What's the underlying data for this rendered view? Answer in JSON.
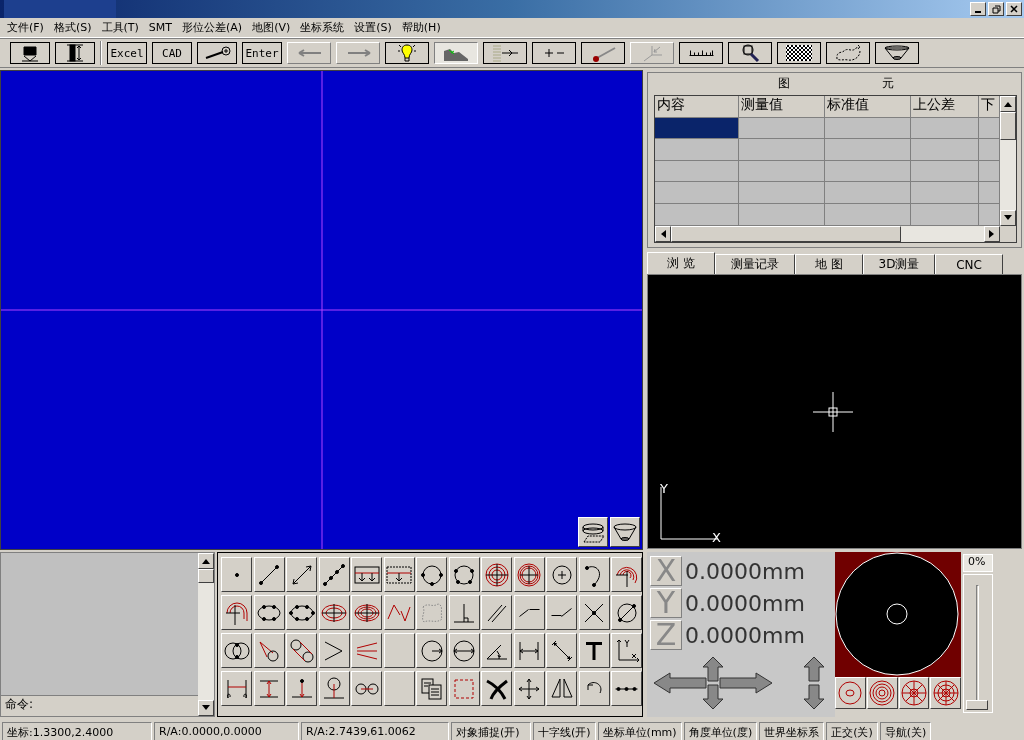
{
  "menu": [
    "文件(F)",
    "格式(S)",
    "工具(T)",
    "SMT",
    "形位公差(A)",
    "地图(V)",
    "坐标系统",
    "设置(S)",
    "帮助(H)"
  ],
  "toolbar": {
    "text_buttons": [
      "Excel",
      "CAD",
      "Enter"
    ]
  },
  "elements_panel": {
    "header_words": [
      "图",
      "元"
    ],
    "columns": [
      "内容",
      "测量值",
      "标准值",
      "上公差",
      "下"
    ],
    "rows": [
      {
        "selected": true
      },
      {
        "selected": false
      },
      {
        "selected": false
      },
      {
        "selected": false
      },
      {
        "selected": false
      }
    ]
  },
  "tabs": [
    {
      "label": "浏 览",
      "selected": true
    },
    {
      "label": "测量记录",
      "selected": false
    },
    {
      "label": "地 图",
      "selected": false
    },
    {
      "label": "3D测量",
      "selected": false
    },
    {
      "label": "CNC",
      "selected": false
    }
  ],
  "preview": {
    "axis_y": "Y",
    "axis_x": "X"
  },
  "command": {
    "label": "命令:"
  },
  "readouts": [
    {
      "axis": "X",
      "value": "0.0000mm"
    },
    {
      "axis": "Y",
      "value": "0.0000mm"
    },
    {
      "axis": "Z",
      "value": "0.0000mm"
    }
  ],
  "light_slider": {
    "reading": "0%",
    "level": 0
  },
  "status_bar": [
    "坐标:1.3300,2.4000",
    "R/A:0.0000,0.0000",
    "R/A:2.7439,61.0062",
    "对象捕捉(开)",
    "十字线(开)",
    "坐标单位(mm)",
    "角度单位(度)",
    "世界坐标系",
    "正交(关)",
    "导航(关)"
  ]
}
